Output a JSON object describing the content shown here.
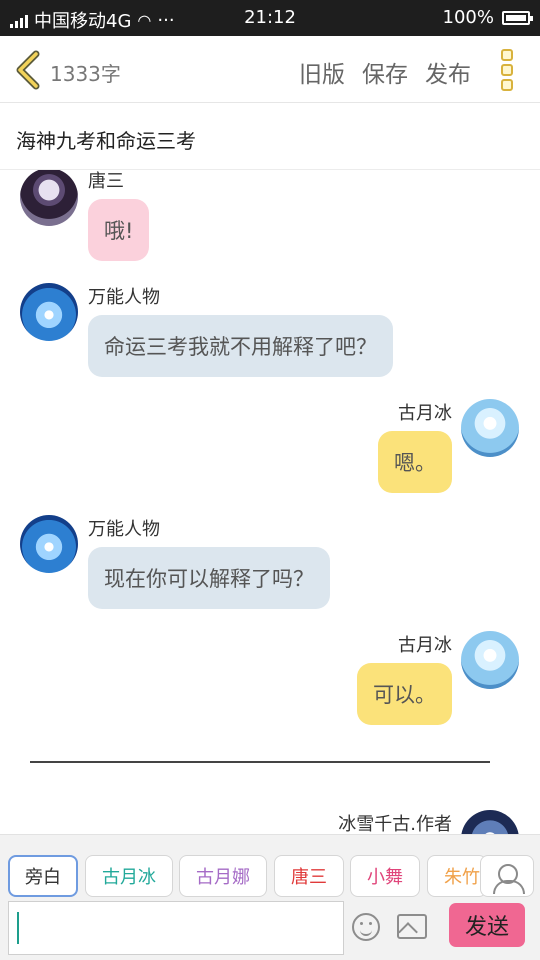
{
  "status_bar": {
    "carrier": "中国移动4G",
    "dots": "···",
    "time": "21:12",
    "battery": "100%"
  },
  "header": {
    "word_count": "1333字",
    "old_version": "旧版",
    "save": "保存",
    "publish": "发布"
  },
  "title": "海神九考和命运三考",
  "messages": [
    {
      "name": "唐三",
      "text": "哦!",
      "side": "left",
      "color": "pink"
    },
    {
      "name": "万能人物",
      "text": "命运三考我就不用解释了吧？",
      "side": "left",
      "color": "blue"
    },
    {
      "name": "古月冰",
      "text": "嗯。",
      "side": "right",
      "color": "yellow"
    },
    {
      "name": "万能人物",
      "text": "现在你可以解释了吗？",
      "side": "left",
      "color": "blue"
    },
    {
      "name": "古月冰",
      "text": "可以。",
      "side": "right",
      "color": "yellow"
    },
    {
      "name": "冰雪千古.作者",
      "text": "",
      "side": "right",
      "color": "none"
    }
  ],
  "characters": [
    {
      "label": "旁白",
      "color": "#555555"
    },
    {
      "label": "古月冰",
      "color": "#22a99a"
    },
    {
      "label": "古月娜",
      "color": "#a56bc6"
    },
    {
      "label": "唐三",
      "color": "#e03a3a"
    },
    {
      "label": "小舞",
      "color": "#e0447a"
    },
    {
      "label": "朱竹",
      "color": "#f0a14a"
    }
  ],
  "composer": {
    "input_value": "",
    "send": "发送"
  }
}
